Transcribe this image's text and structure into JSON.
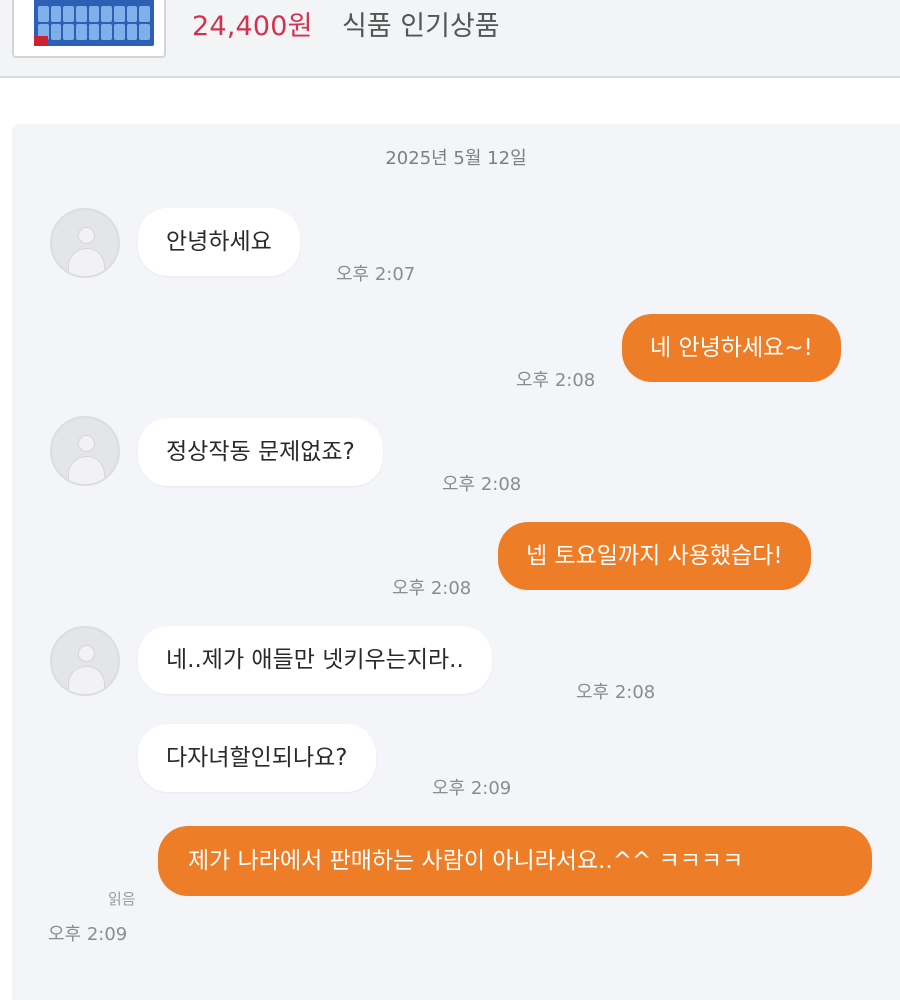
{
  "product": {
    "price": "24,400원",
    "category": "식품 인기상품"
  },
  "chat": {
    "date": "2025년 5월 12일",
    "messages": [
      {
        "sender": "other",
        "text": "안녕하세요",
        "time": "오후 2:07"
      },
      {
        "sender": "me",
        "text": "네 안녕하세요~!",
        "time": "오후 2:08"
      },
      {
        "sender": "other",
        "text": "정상작동 문제없죠?",
        "time": "오후 2:08"
      },
      {
        "sender": "me",
        "text": "넵 토요일까지 사용했습다!",
        "time": "오후 2:08"
      },
      {
        "sender": "other",
        "text": "네..제가 애들만 넷키우는지라..",
        "time": "오후 2:08"
      },
      {
        "sender": "other",
        "text": "다자녀할인되나요?",
        "time": "오후 2:09"
      },
      {
        "sender": "me",
        "text": "제가 나라에서 판매하는 사람이 아니라서요..^^ ㅋㅋㅋㅋ",
        "time": "오후 2:09",
        "status": "읽음"
      }
    ]
  },
  "colors": {
    "outgoing_bubble": "#ee7d27",
    "incoming_bubble": "#ffffff",
    "price": "#d2324f",
    "chat_background": "#f4f5f8"
  },
  "icons": {
    "avatar": "default-profile-avatar-icon"
  }
}
